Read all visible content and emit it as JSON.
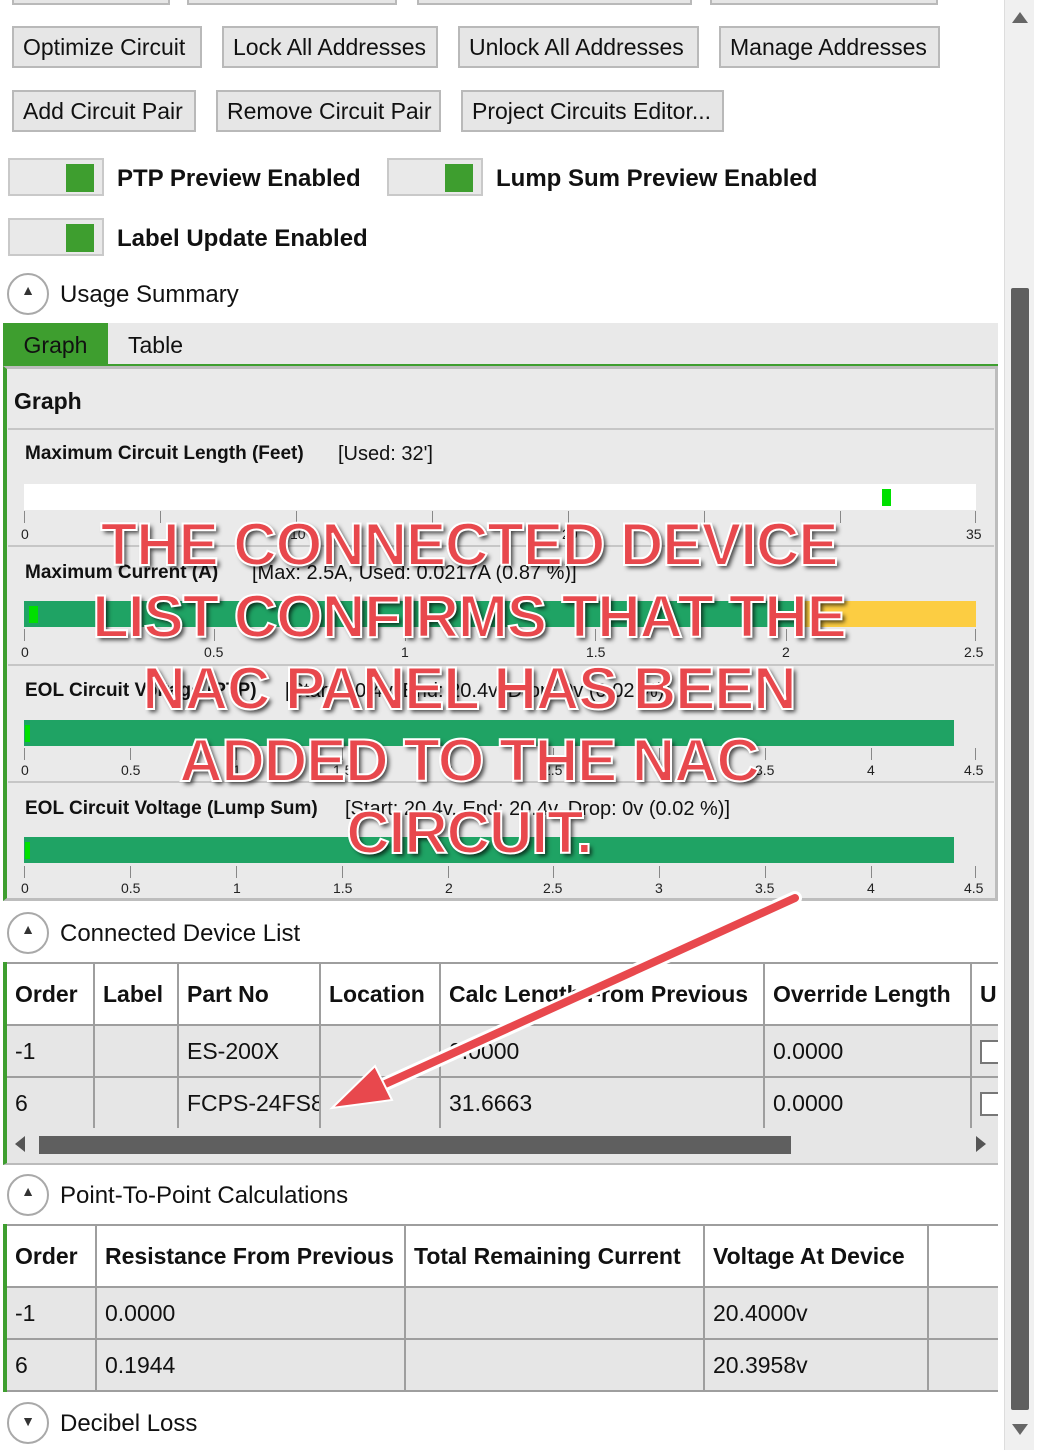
{
  "buttons": {
    "row1": [
      "Optimize Circuit",
      "Lock All Addresses",
      "Unlock All Addresses",
      "Manage Addresses"
    ],
    "row2": [
      "Add Circuit Pair",
      "Remove Circuit Pair",
      "Project Circuits Editor..."
    ]
  },
  "toggles": {
    "ptp_preview": "PTP Preview Enabled",
    "lump_sum_preview": "Lump Sum Preview Enabled",
    "label_update": "Label Update Enabled"
  },
  "usage_summary": {
    "section_label": "Usage Summary",
    "tabs": [
      "Graph",
      "Table"
    ],
    "active_tab": "Graph",
    "graph_heading": "Graph",
    "graphs": [
      {
        "title": "Maximum Circuit Length (Feet)",
        "info": "[Used: 32']",
        "max": 35,
        "used": 32,
        "ticks": [
          "0",
          "10",
          "20",
          "35"
        ],
        "tick_values": [
          0,
          5,
          10,
          15,
          20,
          25,
          30,
          35
        ]
      },
      {
        "title": "Maximum Current (A)",
        "info": "[Max: 2.5A, Used: 0.0217A (0.87 %)]",
        "max": 2.5,
        "used": 0.0217,
        "ticks": [
          "0",
          "0.5",
          "1",
          "1.5",
          "2",
          "2.5"
        ]
      },
      {
        "title": "EOL Circuit Voltage (PTP)",
        "info": "[Start: 20.4v, End: 20.4v, Drop: 0v (0.02 %)]",
        "max": 4.5,
        "ticks": [
          "0",
          "0.5",
          "1",
          "1.5",
          "2",
          "2.5",
          "3",
          "3.5",
          "4",
          "4.5"
        ]
      },
      {
        "title": "EOL Circuit Voltage (Lump Sum)",
        "info": "[Start: 20.4v, End: 20.4v, Drop: 0v (0.02 %)]",
        "max": 4.5,
        "ticks": [
          "0",
          "0.5",
          "1",
          "1.5",
          "2",
          "2.5",
          "3",
          "3.5",
          "4",
          "4.5"
        ]
      }
    ]
  },
  "connected_device_list": {
    "section_label": "Connected Device List",
    "columns": [
      "Order",
      "Label",
      "Part No",
      "Location",
      "Calc Length From Previous",
      "Override Length",
      "U"
    ],
    "rows": [
      [
        "-1",
        "",
        "ES-200X",
        "",
        "0.0000",
        "0.0000",
        ""
      ],
      [
        "6",
        "",
        "FCPS-24FS8",
        "",
        "31.6663",
        "0.0000",
        ""
      ]
    ]
  },
  "point_to_point": {
    "section_label": "Point-To-Point Calculations",
    "columns": [
      "Order",
      "Resistance From Previous",
      "Total Remaining Current",
      "Voltage At Device",
      ""
    ],
    "rows": [
      [
        "-1",
        "0.0000",
        "",
        "20.4000v",
        ""
      ],
      [
        "6",
        "0.1944",
        "",
        "20.3958v",
        ""
      ]
    ]
  },
  "decibel_loss": {
    "section_label": "Decibel Loss"
  },
  "annotation": {
    "lines": [
      "THE CONNECTED DEVICE",
      "LIST CONFIRMS THAT THE",
      "NAC PANEL HAS BEEN",
      "ADDED TO THE NAC",
      "CIRCUIT."
    ]
  },
  "colors": {
    "accent_green": "#3e9e2f",
    "bar_green": "#1fa364",
    "bar_yellow": "#fccd42",
    "marker_green": "#00e000",
    "annotation_red": "#e8484d"
  }
}
